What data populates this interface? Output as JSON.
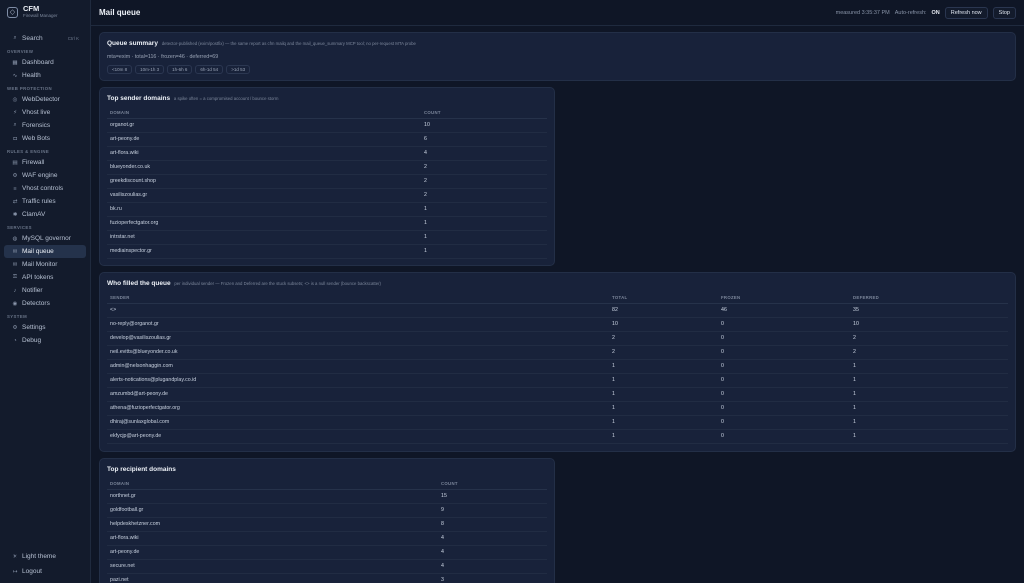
{
  "app": {
    "name": "CFM",
    "subtitle": "Firewall Manager",
    "logo_icon": "shield-icon"
  },
  "search": {
    "label": "Search",
    "shortcut": "Ctrl K"
  },
  "nav": {
    "overview": {
      "label": "OVERVIEW",
      "items": [
        {
          "label": "Dashboard",
          "icon": "grid-icon"
        },
        {
          "label": "Health",
          "icon": "pulse-icon"
        }
      ]
    },
    "web_protection": {
      "label": "WEB PROTECTION",
      "items": [
        {
          "label": "WebDetector",
          "icon": "globe-icon"
        },
        {
          "label": "Vhost live",
          "icon": "bolt-icon"
        },
        {
          "label": "Forensics",
          "icon": "magnifier-icon"
        },
        {
          "label": "Web Bots",
          "icon": "bot-icon"
        }
      ]
    },
    "rules": {
      "label": "RULES & ENGINE",
      "items": [
        {
          "label": "Firewall",
          "icon": "firewall-icon"
        },
        {
          "label": "WAF engine",
          "icon": "engine-icon"
        },
        {
          "label": "Vhost controls",
          "icon": "sliders-icon"
        },
        {
          "label": "Traffic rules",
          "icon": "traffic-icon"
        },
        {
          "label": "ClamAV",
          "icon": "virus-icon"
        }
      ]
    },
    "services": {
      "label": "SERVICES",
      "items": [
        {
          "label": "MySQL governor",
          "icon": "database-icon"
        },
        {
          "label": "Mail queue",
          "icon": "mail-icon"
        },
        {
          "label": "Mail Monitor",
          "icon": "mail-monitor-icon"
        },
        {
          "label": "API tokens",
          "icon": "key-icon"
        },
        {
          "label": "Notifier",
          "icon": "bell-icon"
        },
        {
          "label": "Detectors",
          "icon": "radar-icon"
        }
      ]
    },
    "system": {
      "label": "SYSTEM",
      "items": [
        {
          "label": "Settings",
          "icon": "gear-icon"
        },
        {
          "label": "Debug",
          "icon": "bug-icon"
        }
      ]
    },
    "bottom": {
      "theme": "Light theme",
      "logout": "Logout"
    }
  },
  "header": {
    "title": "Mail queue",
    "measured": "measured 3:35:37 PM",
    "auto_refresh_label": "Auto-refresh:",
    "auto_refresh_state": "ON",
    "refresh_button": "Refresh now",
    "stop_button": "Stop"
  },
  "summary": {
    "title": "Queue summary",
    "note": "detector-published (exim/postfix) — the same report as cfm mailq and the mail_queue_summary MCP tool; no per-request MTA probe",
    "line": "mta=exim · total=116 · frozen=46 · deferred=69",
    "chips": [
      "<10m 8",
      "10m-1h 3",
      "1h-6h 6",
      "6h-1d 54",
      ">1d 53"
    ]
  },
  "sender_domains": {
    "title": "Top sender domains",
    "note": "a spike often = a compromised account / bounce storm",
    "columns": [
      "DOMAIN",
      "COUNT"
    ],
    "rows": [
      [
        "organot.gr",
        "10"
      ],
      [
        "art-peony.de",
        "6"
      ],
      [
        "art-flora.wiki",
        "4"
      ],
      [
        "blueyonder.co.uk",
        "2"
      ],
      [
        "greekdiscount.shop",
        "2"
      ],
      [
        "vasiliszoulias.gr",
        "2"
      ],
      [
        "bk.ru",
        "1"
      ],
      [
        "fuzioperfectgator.org",
        "1"
      ],
      [
        "intrstar.net",
        "1"
      ],
      [
        "mediainspector.gr",
        "1"
      ]
    ]
  },
  "fillers": {
    "title": "Who filled the queue",
    "note": "per individual sender — Frozen and Deferred are the stuck subsets; <> is a null sender (bounce backscatter)",
    "columns": [
      "SENDER",
      "TOTAL",
      "FROZEN",
      "DEFERRED"
    ],
    "rows": [
      [
        "<>",
        "82",
        "46",
        "35"
      ],
      [
        "no-reply@organot.gr",
        "10",
        "0",
        "10"
      ],
      [
        "develop@vasiliszoulias.gr",
        "2",
        "0",
        "2"
      ],
      [
        "neil.evitts@blueyonder.co.uk",
        "2",
        "0",
        "2"
      ],
      [
        "admin@nelsonhaggin.com",
        "1",
        "0",
        "1"
      ],
      [
        "alerts-notications@plugandplay.co.id",
        "1",
        "0",
        "1"
      ],
      [
        "amzumbd@art-peony.de",
        "1",
        "0",
        "1"
      ],
      [
        "athena@fuzioperfectgator.org",
        "1",
        "0",
        "1"
      ],
      [
        "dhiraj@sunlaxglobal.com",
        "1",
        "0",
        "1"
      ],
      [
        "ekfycjp@art-peony.de",
        "1",
        "0",
        "1"
      ]
    ]
  },
  "recipient_domains": {
    "title": "Top recipient domains",
    "columns": [
      "DOMAIN",
      "COUNT"
    ],
    "rows": [
      [
        "northnet.gr",
        "15"
      ],
      [
        "goldfootball.gr",
        "9"
      ],
      [
        "helpdeskhetzner.com",
        "8"
      ],
      [
        "art-flora.wiki",
        "4"
      ],
      [
        "art-peony.de",
        "4"
      ],
      [
        "secure.net",
        "4"
      ],
      [
        "pazi.net",
        "3"
      ]
    ]
  }
}
